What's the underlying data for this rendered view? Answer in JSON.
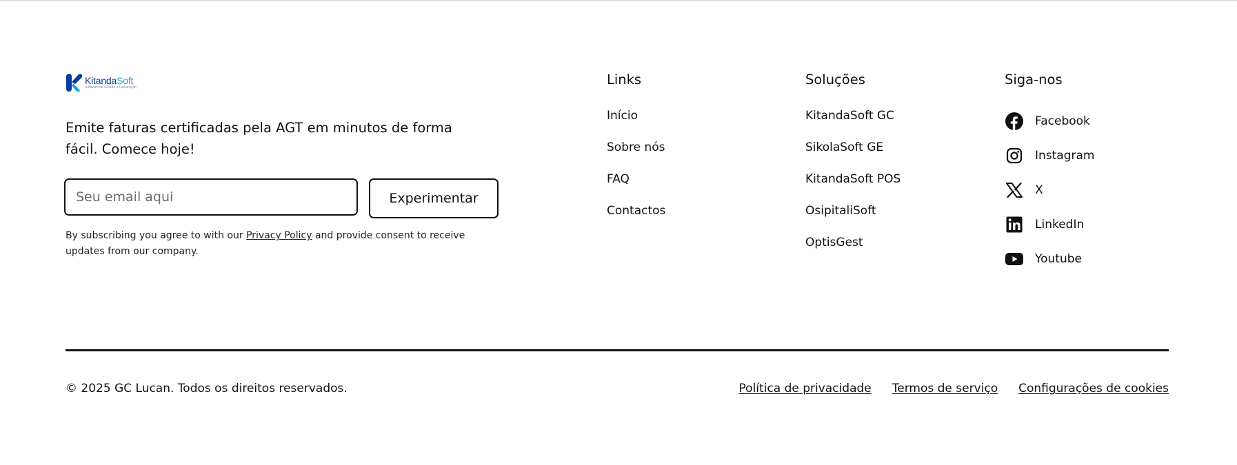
{
  "brand": {
    "name_part1": "Kitanda",
    "name_part2": "Soft",
    "tagline_small": "Software de Gestão e Facturação",
    "colors": {
      "primary": "#0a3a9e",
      "secondary": "#1da1e6"
    }
  },
  "newsletter": {
    "headline": "Emite faturas certificadas pela AGT em minutos de forma fácil. Comece hoje!",
    "email_placeholder": "Seu email aqui",
    "button_label": "Experimentar",
    "consent_before": "By subscribing you agree to with our ",
    "consent_link": "Privacy Policy",
    "consent_after": " and provide consent to receive updates from our company."
  },
  "links_column": {
    "title": "Links",
    "items": [
      "Início",
      "Sobre nós",
      "FAQ",
      "Contactos"
    ]
  },
  "solutions_column": {
    "title": "Soluções",
    "items": [
      "KitandaSoft GC",
      "SikolaSoft GE",
      "KitandaSoft POS",
      "OsipitaliSoft",
      "OptisGest"
    ]
  },
  "social_column": {
    "title": "Siga-nos",
    "items": [
      {
        "label": "Facebook",
        "icon": "facebook-icon"
      },
      {
        "label": "Instagram",
        "icon": "instagram-icon"
      },
      {
        "label": "X",
        "icon": "x-icon"
      },
      {
        "label": "LinkedIn",
        "icon": "linkedin-icon"
      },
      {
        "label": "Youtube",
        "icon": "youtube-icon"
      }
    ]
  },
  "bottom": {
    "copyright": "© 2025 GC Lucan. Todos os direitos reservados.",
    "legal_links": [
      "Política de privacidade",
      "Termos de serviço",
      "Configurações de cookies"
    ]
  }
}
